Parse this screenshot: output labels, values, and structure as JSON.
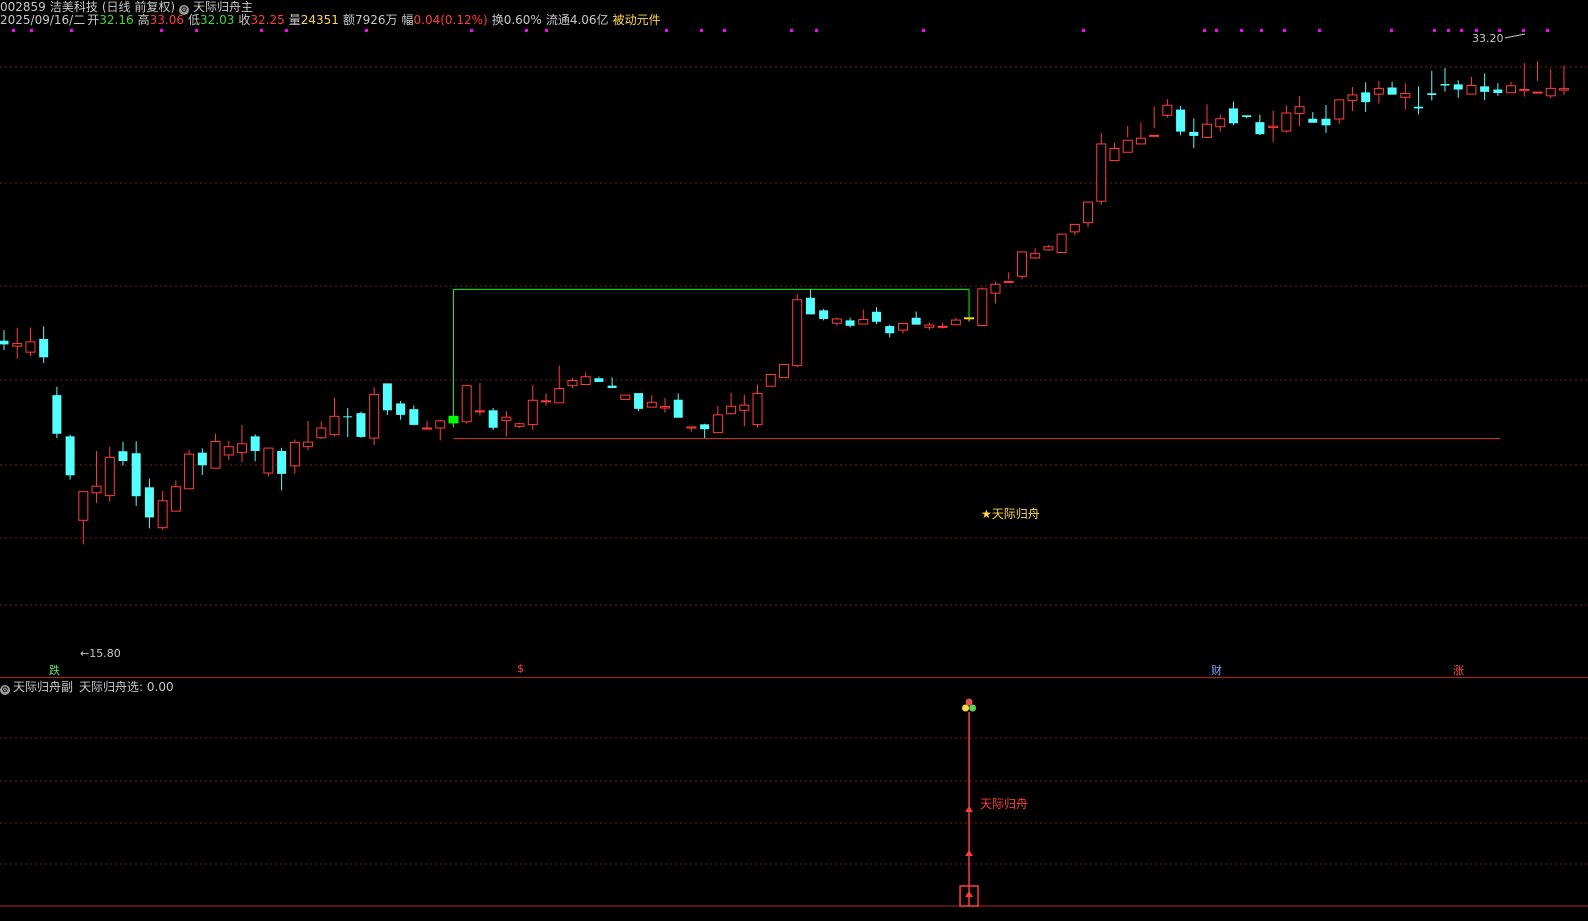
{
  "header": {
    "code": "002859",
    "name": "洁美科技",
    "period": "(日线 前复权)",
    "indicator": "天际归舟主",
    "date": "2025/09/16/二",
    "open_label": "开",
    "open": "32.16",
    "high_label": "高",
    "high": "33.06",
    "low_label": "低",
    "low": "32.03",
    "close_label": "收",
    "close": "32.25",
    "vol_label": "量",
    "vol": "24351",
    "amount_label": "额",
    "amount": "7926万",
    "change_label": "幅",
    "change": "0.04(0.12%)",
    "turnover": "换0.60%",
    "float": "流通4.06亿",
    "component": "被动元件"
  },
  "main_chart": {
    "max_label": "33.20",
    "min_label": "15.80",
    "signal_label": "★天际归舟",
    "markers": [
      {
        "text": "跌",
        "color": "#6ce06c"
      },
      {
        "text": "$",
        "color": "#ff4040"
      },
      {
        "text": "财",
        "color": "#7aa8ff"
      },
      {
        "text": "涨",
        "color": "#ff5050"
      }
    ]
  },
  "sub_chart": {
    "indicator": "天际归舟副",
    "value_label": "天际归舟选: 0.00",
    "signal_text": "天际归舟"
  },
  "colors": {
    "up": "#ff3c3c",
    "down": "#54ffff",
    "grid": "#7a1a1a",
    "box": "#00ff00",
    "support": "#d23c3c",
    "signal_bar": "#ffd800",
    "signal_start": "#00ff00",
    "dots": "#ff00ff"
  },
  "ohlc": [
    [
      23.45,
      23.82,
      23.12,
      23.32
    ],
    [
      23.26,
      23.9,
      22.82,
      23.35
    ],
    [
      23.05,
      23.91,
      22.91,
      23.41
    ],
    [
      23.51,
      23.95,
      22.67,
      22.87
    ],
    [
      21.55,
      21.84,
      20.05,
      20.2
    ],
    [
      20.11,
      20.17,
      18.6,
      18.75
    ],
    [
      17.18,
      18.2,
      16.34,
      18.18
    ],
    [
      18.14,
      19.6,
      17.78,
      18.37
    ],
    [
      18.04,
      19.75,
      17.83,
      19.38
    ],
    [
      19.59,
      19.92,
      19.09,
      19.25
    ],
    [
      19.52,
      19.94,
      17.68,
      18.02
    ],
    [
      18.33,
      18.63,
      16.9,
      17.28
    ],
    [
      16.92,
      18.2,
      16.85,
      17.86
    ],
    [
      17.5,
      18.57,
      17.51,
      18.35
    ],
    [
      18.28,
      19.65,
      18.26,
      19.49
    ],
    [
      19.54,
      19.69,
      18.76,
      19.1
    ],
    [
      19.0,
      20.21,
      19.06,
      19.93
    ],
    [
      19.46,
      19.95,
      19.29,
      19.75
    ],
    [
      19.55,
      20.51,
      19.21,
      19.85
    ],
    [
      20.11,
      20.18,
      19.24,
      19.6
    ],
    [
      18.83,
      19.53,
      18.7,
      19.7
    ],
    [
      19.6,
      19.71,
      18.22,
      18.8
    ],
    [
      19.08,
      20.0,
      18.81,
      19.9
    ],
    [
      19.75,
      20.65,
      19.63,
      19.91
    ],
    [
      20.06,
      20.64,
      20.02,
      20.4
    ],
    [
      20.17,
      21.46,
      20.11,
      20.81
    ],
    [
      20.81,
      21.1,
      20.09,
      20.78
    ],
    [
      20.92,
      20.97,
      20.06,
      20.09
    ],
    [
      20.05,
      21.82,
      19.81,
      21.57
    ],
    [
      21.96,
      21.89,
      20.86,
      21.02
    ],
    [
      21.26,
      21.35,
      20.69,
      20.86
    ],
    [
      21.06,
      21.19,
      20.5,
      20.51
    ],
    [
      20.4,
      20.65,
      20.34,
      20.4
    ],
    [
      20.4,
      20.7,
      19.97,
      20.65
    ],
    [
      20.58,
      20.91,
      20.43,
      20.81
    ],
    [
      20.62,
      21.8,
      20.55,
      21.88
    ],
    [
      21.0,
      21.97,
      20.83,
      21.0
    ],
    [
      21.02,
      21.1,
      20.33,
      20.41
    ],
    [
      20.67,
      20.99,
      20.1,
      20.78
    ],
    [
      20.46,
      20.59,
      20.4,
      20.55
    ],
    [
      20.52,
      21.91,
      20.34,
      21.37
    ],
    [
      21.32,
      21.61,
      21.18,
      21.35
    ],
    [
      21.28,
      22.58,
      21.31,
      21.78
    ],
    [
      21.88,
      22.16,
      21.79,
      22.06
    ],
    [
      21.92,
      22.34,
      22.05,
      22.19
    ],
    [
      22.14,
      22.2,
      22.16,
      22.01
    ],
    [
      21.88,
      22.17,
      21.8,
      21.8
    ],
    [
      21.4,
      21.52,
      21.55,
      21.55
    ],
    [
      21.62,
      21.6,
      20.99,
      21.07
    ],
    [
      21.13,
      21.55,
      21.3,
      21.3
    ],
    [
      21.1,
      21.45,
      20.94,
      21.15
    ],
    [
      21.39,
      21.61,
      20.93,
      20.76
    ],
    [
      20.4,
      20.46,
      20.28,
      20.44
    ],
    [
      20.53,
      20.55,
      20.03,
      20.36
    ],
    [
      20.24,
      21.18,
      20.41,
      20.86
    ],
    [
      20.9,
      21.63,
      20.88,
      21.16
    ],
    [
      21.02,
      21.56,
      20.46,
      21.2
    ],
    [
      20.52,
      21.92,
      20.42,
      21.61
    ],
    [
      21.86,
      22.07,
      21.95,
      22.27
    ],
    [
      22.16,
      22.46,
      22.38,
      22.62
    ],
    [
      22.58,
      25.08,
      22.53,
      24.88
    ],
    [
      24.95,
      25.24,
      24.44,
      24.37
    ],
    [
      24.51,
      24.56,
      24.16,
      24.21
    ],
    [
      24.06,
      24.26,
      23.98,
      24.21
    ],
    [
      24.16,
      24.25,
      23.91,
      23.97
    ],
    [
      24.03,
      24.54,
      24.03,
      24.19
    ],
    [
      24.46,
      24.62,
      24.03,
      24.11
    ],
    [
      23.96,
      24.01,
      23.57,
      23.71
    ],
    [
      23.82,
      24.05,
      23.7,
      24.05
    ],
    [
      24.25,
      24.47,
      24.02,
      24.01
    ],
    [
      23.92,
      24.09,
      23.82,
      24.0
    ],
    [
      23.92,
      24.08,
      23.88,
      23.95
    ],
    [
      24.01,
      24.25,
      23.99,
      24.17
    ],
    [
      24.23,
      24.37,
      24.12,
      24.25
    ],
    [
      23.98,
      25.31,
      23.95,
      25.26
    ],
    [
      25.11,
      25.5,
      24.75,
      25.42
    ],
    [
      25.51,
      25.84,
      25.59,
      25.52
    ],
    [
      25.7,
      26.43,
      25.6,
      26.55
    ],
    [
      26.34,
      26.68,
      26.31,
      26.49
    ],
    [
      26.62,
      26.79,
      26.59,
      26.73
    ],
    [
      26.53,
      27.15,
      26.53,
      27.17
    ],
    [
      27.25,
      27.46,
      27.14,
      27.51
    ],
    [
      27.57,
      28.02,
      27.41,
      28.29
    ],
    [
      28.32,
      30.7,
      28.2,
      30.32
    ],
    [
      29.74,
      30.36,
      29.84,
      30.16
    ],
    [
      30.03,
      30.95,
      30.55,
      30.45
    ],
    [
      30.32,
      31.05,
      30.53,
      30.52
    ],
    [
      30.62,
      31.63,
      30.87,
      30.62
    ],
    [
      31.32,
      31.88,
      31.24,
      31.67
    ],
    [
      31.52,
      31.64,
      30.62,
      30.75
    ],
    [
      30.74,
      31.21,
      30.17,
      30.6
    ],
    [
      30.55,
      31.71,
      30.53,
      31.01
    ],
    [
      30.92,
      31.35,
      30.76,
      31.2
    ],
    [
      31.56,
      31.8,
      30.97,
      31.04
    ],
    [
      31.32,
      31.31,
      31.22,
      31.26
    ],
    [
      31.08,
      31.34,
      30.63,
      30.66
    ],
    [
      30.89,
      31.48,
      30.39,
      30.94
    ],
    [
      30.77,
      31.67,
      30.71,
      31.4
    ],
    [
      31.38,
      31.99,
      30.94,
      31.62
    ],
    [
      31.2,
      31.43,
      31.18,
      31.06
    ],
    [
      31.2,
      31.68,
      30.71,
      30.97
    ],
    [
      31.19,
      31.76,
      31.02,
      31.86
    ],
    [
      31.84,
      32.31,
      31.47,
      32.03
    ],
    [
      32.12,
      32.47,
      31.44,
      31.78
    ],
    [
      32.06,
      32.52,
      31.73,
      32.26
    ],
    [
      32.29,
      32.49,
      32.24,
      32.04
    ],
    [
      31.95,
      32.44,
      31.52,
      32.08
    ],
    [
      31.62,
      32.33,
      31.35,
      31.56
    ],
    [
      32.09,
      32.87,
      31.84,
      32.03
    ],
    [
      32.41,
      32.97,
      32.15,
      32.36
    ],
    [
      32.4,
      32.54,
      31.93,
      32.22
    ],
    [
      32.06,
      32.66,
      32.08,
      32.36
    ],
    [
      32.33,
      32.78,
      31.85,
      32.14
    ],
    [
      32.22,
      32.44,
      32.0,
      32.1
    ],
    [
      32.11,
      32.49,
      32.25,
      32.35
    ],
    [
      32.18,
      33.14,
      31.97,
      32.22
    ],
    [
      32.12,
      33.2,
      32.52,
      32.13
    ],
    [
      32.0,
      32.93,
      31.92,
      32.26
    ],
    [
      32.2,
      33.06,
      32.03,
      32.25
    ]
  ]
}
